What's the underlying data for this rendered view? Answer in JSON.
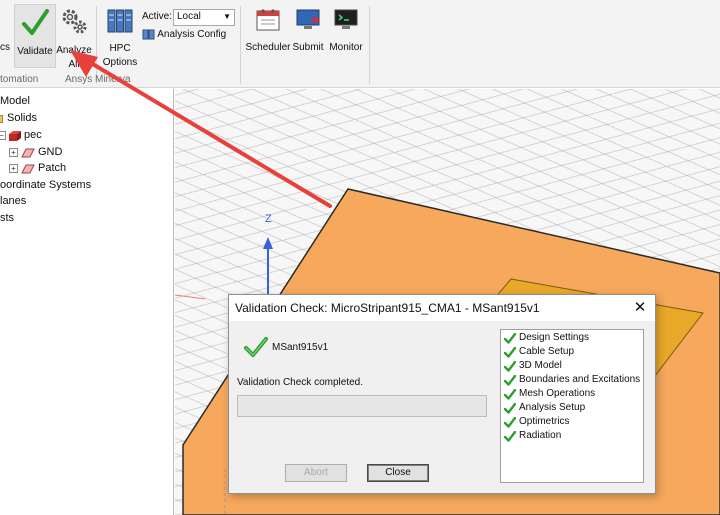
{
  "ribbon": {
    "partial_left_label": "cs",
    "validate_label": "Validate",
    "analyze_label_line1": "Analyze",
    "analyze_label_line2": "All",
    "hpc_label_line1": "HPC",
    "hpc_label_line2": "Options",
    "active_label": "Active:",
    "active_value": "Local",
    "analysis_config_label": "Analysis Config",
    "scheduler_label": "Scheduler",
    "submit_label": "Submit",
    "monitor_label": "Monitor",
    "group_automation": "tomation",
    "group_ansys_minerva": "Ansys Minerva"
  },
  "tree": {
    "items": [
      {
        "label": "Model"
      },
      {
        "label": "Solids"
      },
      {
        "label": "pec"
      },
      {
        "label": "GND"
      },
      {
        "label": "Patch"
      },
      {
        "label": "oordinate Systems"
      },
      {
        "label": "lanes"
      },
      {
        "label": "sts"
      }
    ]
  },
  "viewport": {
    "axis_z_label": "Z"
  },
  "dialog": {
    "title": "Validation Check: MicroStripant915_CMA1 - MSant915v1",
    "close_glyph": "✕",
    "model_name": "MSant915v1",
    "status": "Validation Check completed.",
    "abort_label": "Abort",
    "close_label": "Close",
    "checks": [
      "Design Settings",
      "Cable Setup",
      "3D Model",
      "Boundaries and Excitations",
      "Mesh Operations",
      "Analysis Setup",
      "Optimetrics",
      "Radiation"
    ]
  },
  "colors": {
    "substrate": "#f6a85c",
    "patch": "#e8a82a",
    "annotation_arrow": "#e8403a",
    "check_green": "#2e9e2e"
  }
}
